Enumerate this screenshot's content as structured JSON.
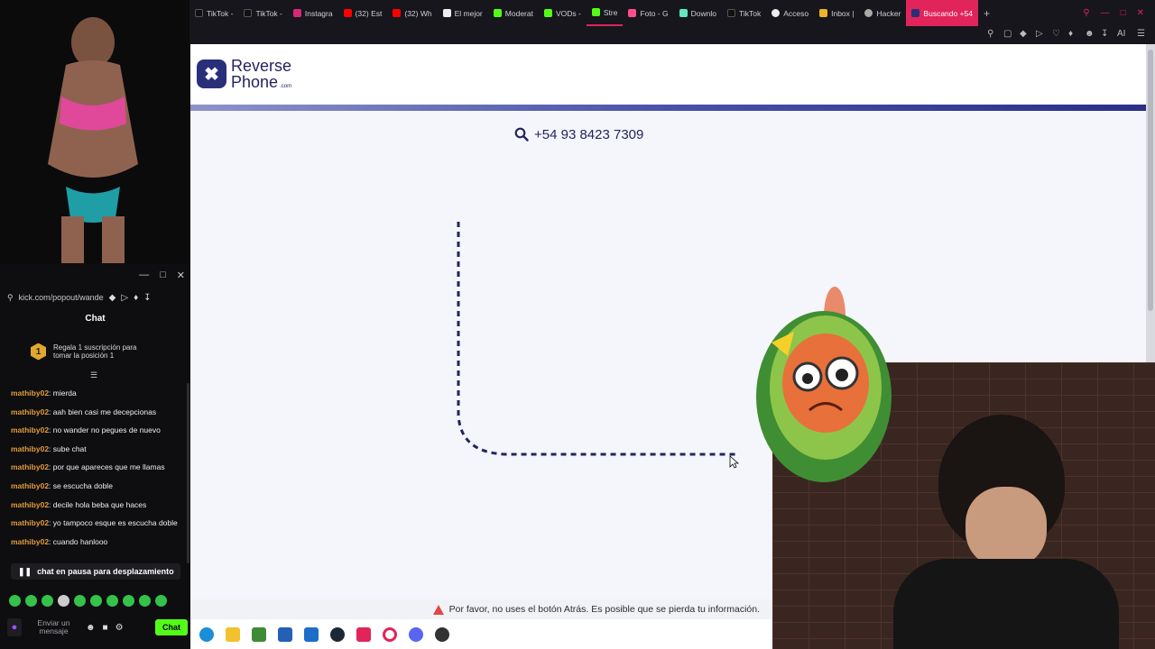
{
  "browser": {
    "tabs": [
      {
        "label": "TikTok -",
        "color": "#111111"
      },
      {
        "label": "TikTok -",
        "color": "#111111"
      },
      {
        "label": "Instagra",
        "color": "#d62976"
      },
      {
        "label": "(32) Est",
        "color": "#ff0000"
      },
      {
        "label": "(32) Wh",
        "color": "#ff0000"
      },
      {
        "label": "El mejor",
        "color": "#eeeeee"
      },
      {
        "label": "Moderat",
        "color": "#53fc18"
      },
      {
        "label": "VODs -",
        "color": "#53fc18"
      },
      {
        "label": "Stre",
        "color": "#53fc18"
      },
      {
        "label": "Foto - G",
        "color": "#ff4f8b"
      },
      {
        "label": "Downlo",
        "color": "#63e6be"
      },
      {
        "label": "TikTok",
        "color": "#111111"
      },
      {
        "label": "Acceso",
        "color": "#eeeeee"
      },
      {
        "label": "Inbox |",
        "color": "#f0b429"
      },
      {
        "label": "Hacker",
        "color": "#aaaaaa"
      },
      {
        "label": "Buscando +54",
        "color": "#2a2f7a",
        "active": true
      }
    ],
    "new_tab": "+",
    "ai_label": "AI"
  },
  "site": {
    "logo_line1": "Reverse",
    "logo_line2": "Phone",
    "logo_suffix": ".com",
    "search_phone": "+54 93 8423 7309"
  },
  "warning": {
    "text": "Por favor, no uses el botón Atrás. Es posible que se pierda tu información."
  },
  "chat": {
    "url": "kick.com/popout/wande",
    "title": "Chat",
    "sub_rank": "1",
    "sub_text": "Regala 1 suscripción para tomar la posición 1",
    "messages": [
      {
        "user": "mathiby02",
        "text": ": mierda"
      },
      {
        "user": "mathiby02",
        "text": ": aah bien casi me decepcionas"
      },
      {
        "user": "mathiby02",
        "text": ": no wander no pegues de nuevo"
      },
      {
        "user": "mathiby02",
        "text": ": sube chat"
      },
      {
        "user": "mathiby02",
        "text": ": por que apareces que me llamas"
      },
      {
        "user": "mathiby02",
        "text": ": se escucha doble"
      },
      {
        "user": "mathiby02",
        "text": ": decile hola beba que haces"
      },
      {
        "user": "mathiby02",
        "text": ": yo tampoco esque es escucha doble"
      },
      {
        "user": "mathiby02",
        "text": ": cuando hanlooo"
      }
    ],
    "paused_text": "chat en pausa para desplazamiento",
    "input_placeholder": "Enviar un mensaje",
    "send_button": "Chat"
  },
  "colors": {
    "brand": "#2a2f7a",
    "kick_green": "#53fc18",
    "active_tab": "#e1245a"
  }
}
